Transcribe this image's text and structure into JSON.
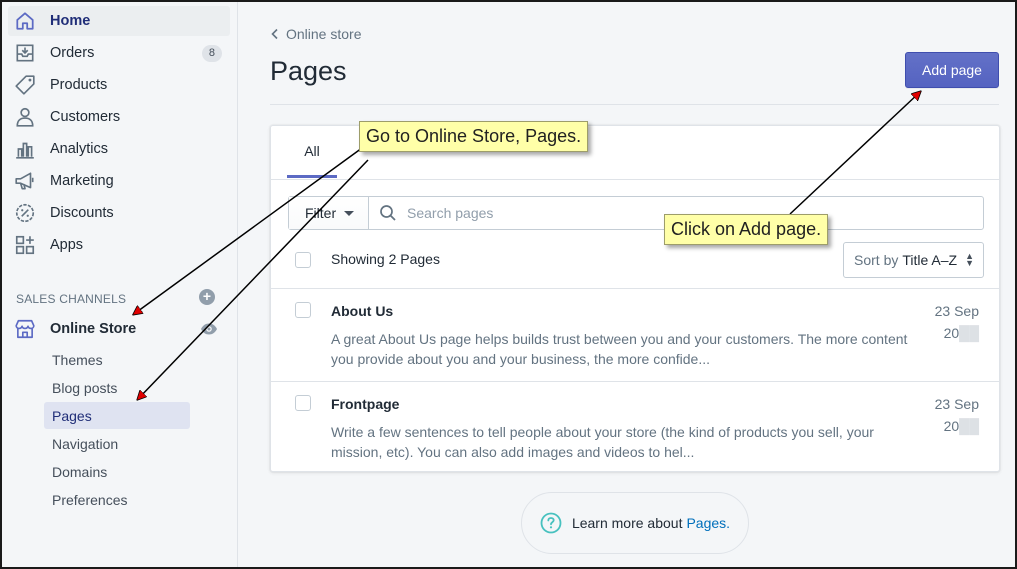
{
  "sidebar": {
    "items": [
      {
        "label": "Home",
        "icon": "home-icon"
      },
      {
        "label": "Orders",
        "icon": "orders-icon",
        "badge": "8"
      },
      {
        "label": "Products",
        "icon": "tag-icon"
      },
      {
        "label": "Customers",
        "icon": "person-icon"
      },
      {
        "label": "Analytics",
        "icon": "bar-chart-icon"
      },
      {
        "label": "Marketing",
        "icon": "megaphone-icon"
      },
      {
        "label": "Discounts",
        "icon": "discount-icon"
      },
      {
        "label": "Apps",
        "icon": "apps-icon"
      }
    ],
    "sales_channels_title": "SALES CHANNELS",
    "online_store": "Online Store",
    "sub_items": [
      "Themes",
      "Blog posts",
      "Pages",
      "Navigation",
      "Domains",
      "Preferences"
    ],
    "active_sub": "Pages"
  },
  "main": {
    "breadcrumb": "Online store",
    "title": "Pages",
    "add_button": "Add page",
    "tab_all": "All",
    "filter_label": "Filter",
    "search_placeholder": "Search pages",
    "showing": "Showing 2 Pages",
    "sort_prefix": "Sort by",
    "sort_value": "Title A–Z",
    "rows": [
      {
        "title": "About Us",
        "desc": "A great About Us page helps builds trust between you and your customers. The more content you provide about you and your business, the more confide...",
        "date_line1": "23 Sep",
        "date_line2": "20"
      },
      {
        "title": "Frontpage",
        "desc": "Write a few sentences to tell people about your store (the kind of products you sell, your mission, etc). You can also add images and videos to hel...",
        "date_line1": "23 Sep",
        "date_line2": "20"
      }
    ],
    "learn_text": "Learn more about",
    "learn_link": "Pages."
  },
  "callouts": {
    "online_store": "Go to Online Store, Pages.",
    "add_page": "Click on Add page."
  },
  "colors": {
    "primary_button": "#5c6ac4",
    "active_text": "#202e78",
    "callout_bg": "#ffffa8",
    "arrow_head": "#e00000"
  }
}
